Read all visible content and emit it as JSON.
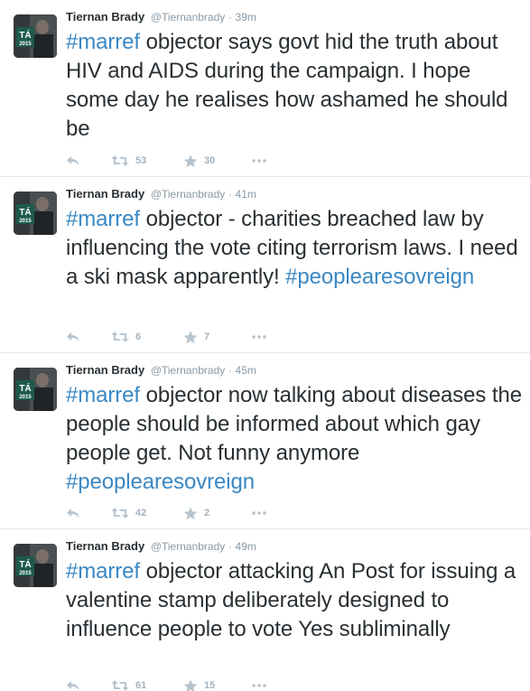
{
  "colors": {
    "hashtag": "#3b88c3",
    "name": "#292f33",
    "meta": "#8899a6",
    "action": "#a4b2bd",
    "divider": "#e1e8ed"
  },
  "icons": {
    "reply": "reply-icon",
    "retweet": "retweet-icon",
    "favorite": "star-icon",
    "more": "more-icon"
  },
  "tweets": [
    {
      "avatar_badge": "TÁ",
      "avatar_year": "2015",
      "name": "Tiernan Brady",
      "handle": "@Tiernanbrady",
      "sep": "·",
      "time": "39m",
      "hashtag": "#marref",
      "text": " objector says govt hid the truth about HIV and AIDS during the campaign. I hope some day he realises how ashamed he should be",
      "trailing_hashtag": "",
      "retweets": "53",
      "favorites": "30"
    },
    {
      "avatar_badge": "TÁ",
      "avatar_year": "2015",
      "name": "Tiernan Brady",
      "handle": "@Tiernanbrady",
      "sep": "·",
      "time": "41m",
      "hashtag": "#marref",
      "text": " objector - charities breached law by influencing the vote citing terrorism laws. I need a ski mask apparently! ",
      "trailing_hashtag": "#peoplearesovreign",
      "retweets": "6",
      "favorites": "7"
    },
    {
      "avatar_badge": "TÁ",
      "avatar_year": "2015",
      "name": "Tiernan Brady",
      "handle": "@Tiernanbrady",
      "sep": "·",
      "time": "45m",
      "hashtag": "#marref",
      "text": " objector now talking about diseases the people should be informed about which gay people get. Not funny anymore ",
      "trailing_hashtag": "#peoplearesovreign",
      "retweets": "42",
      "favorites": "2"
    },
    {
      "avatar_badge": "TÁ",
      "avatar_year": "2015",
      "name": "Tiernan Brady",
      "handle": "@Tiernanbrady",
      "sep": "·",
      "time": "49m",
      "hashtag": "#marref",
      "text": " objector attacking An Post for issuing a valentine stamp deliberately designed to influence people to vote Yes subliminally",
      "trailing_hashtag": "",
      "retweets": "61",
      "favorites": "15"
    }
  ]
}
